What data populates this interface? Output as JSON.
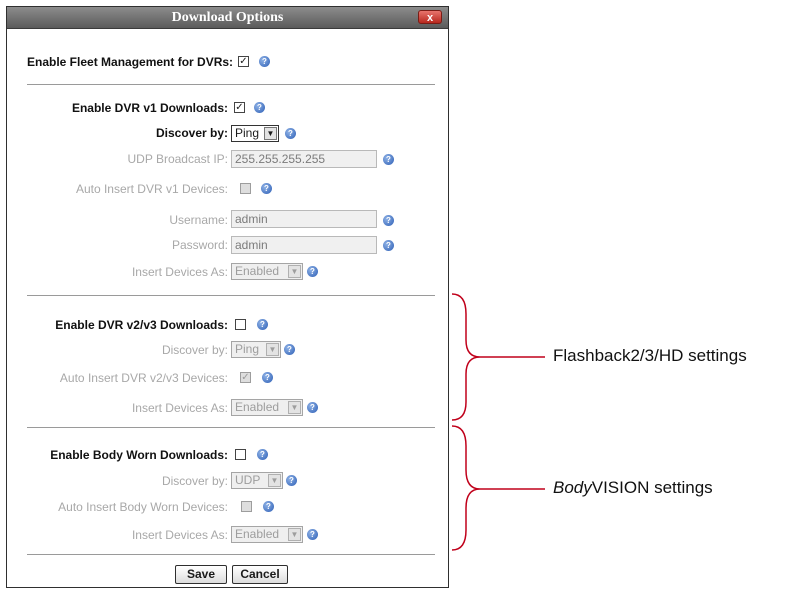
{
  "dialog": {
    "title": "Download Options",
    "close_label": "x",
    "fleet": {
      "label": "Enable Fleet Management for DVRs:",
      "checked": true
    },
    "dvr_v1": {
      "enable_label": "Enable DVR v1 Downloads:",
      "discover_label": "Discover by:",
      "discover_value": "Ping",
      "udp_label": "UDP Broadcast IP:",
      "udp_value": "255.255.255.255",
      "auto_label": "Auto Insert DVR v1 Devices:",
      "username_label": "Username:",
      "username_value": "admin",
      "password_label": "Password:",
      "password_value": "admin",
      "insert_label": "Insert Devices As:",
      "insert_value": "Enabled"
    },
    "dvr_v2v3": {
      "enable_label": "Enable DVR v2/v3 Downloads:",
      "discover_label": "Discover by:",
      "discover_value": "Ping",
      "auto_label": "Auto Insert DVR v2/v3 Devices:",
      "insert_label": "Insert Devices As:",
      "insert_value": "Enabled"
    },
    "body_worn": {
      "enable_label": "Enable Body Worn Downloads:",
      "discover_label": "Discover by:",
      "discover_value": "UDP",
      "auto_label": "Auto Insert Body Worn Devices:",
      "insert_label": "Insert Devices As:",
      "insert_value": "Enabled"
    },
    "buttons": {
      "save": "Save",
      "cancel": "Cancel"
    }
  },
  "annotations": {
    "flashback": "Flashback2/3/HD  settings",
    "bodyvision_italic": "Body",
    "bodyvision_rest": "VISION settings"
  },
  "icons": {
    "help": "help-icon",
    "close": "close-icon",
    "dropdown": "chevron-down-icon"
  },
  "colors": {
    "titlebar": "#6e6e6e",
    "close": "#c8372c",
    "help": "#2c5eb5",
    "bracket": "#c0001a"
  }
}
